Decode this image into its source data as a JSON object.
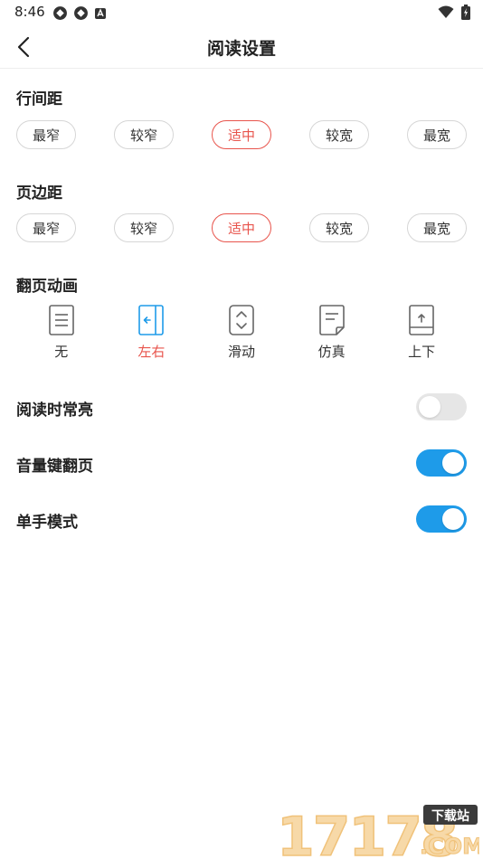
{
  "status_bar": {
    "time": "8:46",
    "icons": [
      "sync-icon",
      "sync-icon",
      "app-notification-icon",
      "wifi-icon",
      "battery-charging-icon"
    ]
  },
  "header": {
    "title": "阅读设置",
    "back_icon": "chevron-left-icon"
  },
  "line_spacing": {
    "label": "行间距",
    "options": [
      "最窄",
      "较窄",
      "适中",
      "较宽",
      "最宽"
    ],
    "selected": "适中"
  },
  "page_margin": {
    "label": "页边距",
    "options": [
      "最窄",
      "较窄",
      "适中",
      "较宽",
      "最宽"
    ],
    "selected": "适中"
  },
  "page_animation": {
    "label": "翻页动画",
    "options": [
      {
        "label": "无",
        "icon": "page-none-icon"
      },
      {
        "label": "左右",
        "icon": "page-horizontal-icon"
      },
      {
        "label": "滑动",
        "icon": "page-slide-icon"
      },
      {
        "label": "仿真",
        "icon": "page-curl-icon"
      },
      {
        "label": "上下",
        "icon": "page-vertical-icon"
      }
    ],
    "selected": "左右"
  },
  "toggles": [
    {
      "label": "阅读时常亮",
      "on": false
    },
    {
      "label": "音量键翻页",
      "on": true
    },
    {
      "label": "单手模式",
      "on": true
    }
  ],
  "colors": {
    "accent_selected": "#e8544c",
    "anim_selected": "#1e9be9",
    "toggle_on": "#1e9be9",
    "toggle_off": "#e6e6e6"
  },
  "watermark": {
    "number": "17178",
    "badge": "下载站",
    "domain": ".COM"
  }
}
